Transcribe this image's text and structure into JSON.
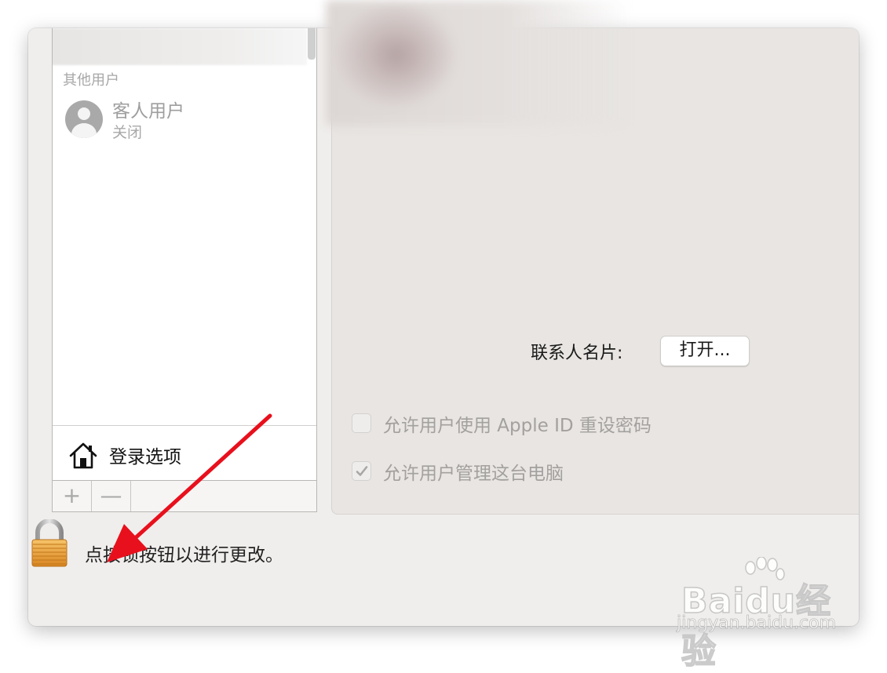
{
  "user_list": {
    "section_label": "其他用户",
    "guest": {
      "name": "客人用户",
      "status": "关闭"
    },
    "login_options_label": "登录选项",
    "add_button": "+",
    "remove_button": "—"
  },
  "detail": {
    "contact_card_label": "联系人名片:",
    "open_button_label": "打开...",
    "checkboxes": [
      {
        "label": "允许用户使用 Apple ID 重设密码",
        "checked": false
      },
      {
        "label": "允许用户管理这台电脑",
        "checked": true
      }
    ]
  },
  "lock": {
    "icon": "lock-icon",
    "text": "点按锁按钮以进行更改。"
  },
  "watermark": {
    "brand": "Baidu经验",
    "url": "jingyan.baidu.com"
  },
  "colors": {
    "window_bg": "#f0eeec",
    "panel_bg": "#e8e5e2",
    "annotation_arrow": "#e8101c",
    "lock_gold": "#f0a63a"
  }
}
